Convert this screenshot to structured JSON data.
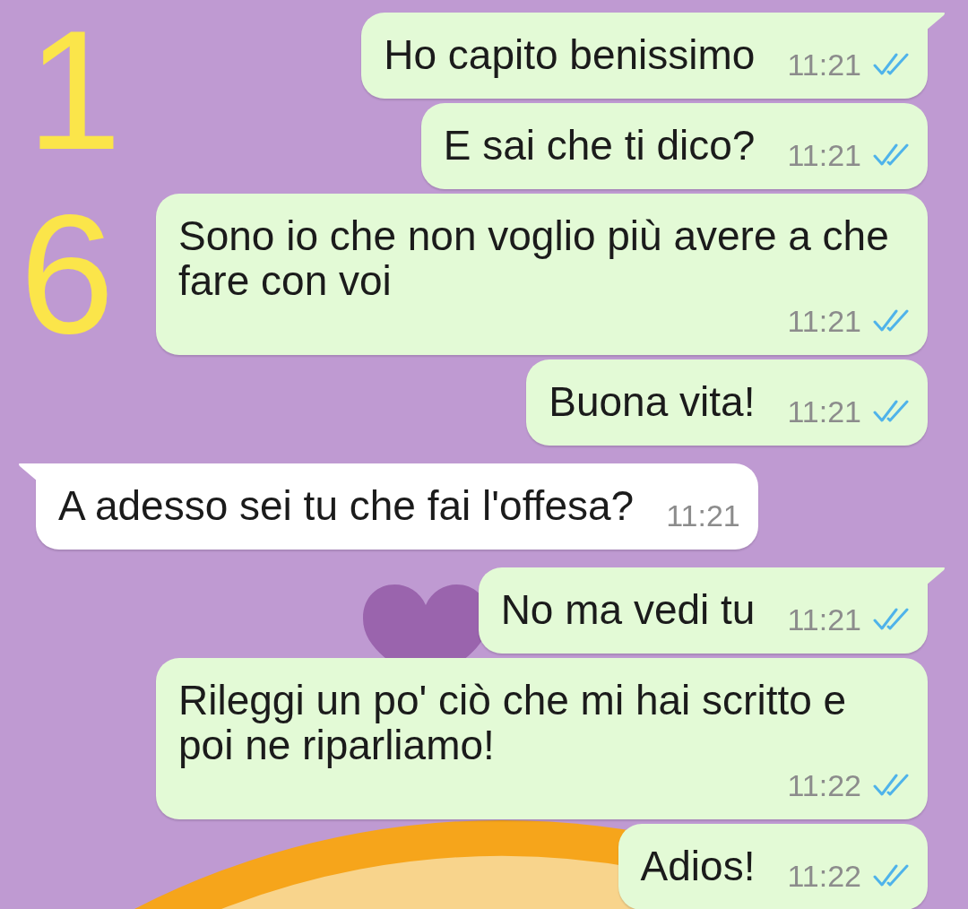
{
  "annotations": [
    "1",
    "6"
  ],
  "messages": [
    {
      "kind": "outgoing",
      "text": "Ho capito benissimo",
      "time": "11:21",
      "read": true,
      "tail": true
    },
    {
      "kind": "outgoing",
      "text": "E sai che ti dico?",
      "time": "11:21",
      "read": true,
      "tail": false
    },
    {
      "kind": "outgoing",
      "text": "Sono io che non voglio più avere a che fare con voi",
      "time": "11:21",
      "read": true,
      "tail": false
    },
    {
      "kind": "outgoing",
      "text": "Buona vita!",
      "time": "11:21",
      "read": true,
      "tail": false
    },
    {
      "kind": "incoming",
      "text": "A adesso sei tu che fai l'offesa?",
      "time": "11:21",
      "tail": true
    },
    {
      "kind": "outgoing",
      "text": "No ma vedi tu",
      "time": "11:21",
      "read": true,
      "tail": true
    },
    {
      "kind": "outgoing",
      "text": "Rileggi un po' ciò che mi hai scritto e poi ne riparliamo!",
      "time": "11:22",
      "read": true,
      "tail": false
    },
    {
      "kind": "outgoing",
      "text": "Adios!",
      "time": "11:22",
      "read": true,
      "tail": false
    }
  ]
}
